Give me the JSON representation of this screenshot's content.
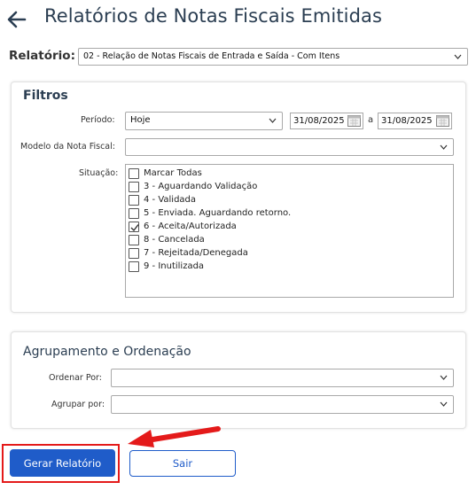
{
  "header": {
    "title": "Relatórios de Notas Fiscais Emitidas",
    "back_icon": "arrow-left-icon"
  },
  "relatorio": {
    "label": "Relatório:",
    "value": "02 - Relação de Notas Fiscais de Entrada e Saída - Com Itens"
  },
  "filtros": {
    "title": "Filtros",
    "periodo": {
      "label": "Período:",
      "value": "Hoje",
      "date_from": "31/08/2025",
      "separator": "a",
      "date_to": "31/08/2025"
    },
    "modelo": {
      "label": "Modelo da Nota Fiscal:",
      "value": ""
    },
    "situacao": {
      "label": "Situação:",
      "options": [
        {
          "label": "Marcar Todas",
          "checked": false
        },
        {
          "label": "3 - Aguardando Validação",
          "checked": false
        },
        {
          "label": "4 - Validada",
          "checked": false
        },
        {
          "label": "5 - Enviada. Aguardando retorno.",
          "checked": false
        },
        {
          "label": "6 - Aceita/Autorizada",
          "checked": true
        },
        {
          "label": "8 - Cancelada",
          "checked": false
        },
        {
          "label": "7 - Rejeitada/Denegada",
          "checked": false
        },
        {
          "label": "9 - Inutilizada",
          "checked": false
        }
      ]
    }
  },
  "agrupamento": {
    "title": "Agrupamento e Ordenação",
    "ordenar": {
      "label": "Ordenar Por:",
      "value": ""
    },
    "agrupar": {
      "label": "Agrupar por:",
      "value": ""
    }
  },
  "buttons": {
    "generate_label": "Gerar Relatório",
    "exit_label": "Sair"
  },
  "colors": {
    "primary": "#1f5cc9",
    "title": "#2b3e52",
    "annotation_red": "#e41a1a"
  }
}
